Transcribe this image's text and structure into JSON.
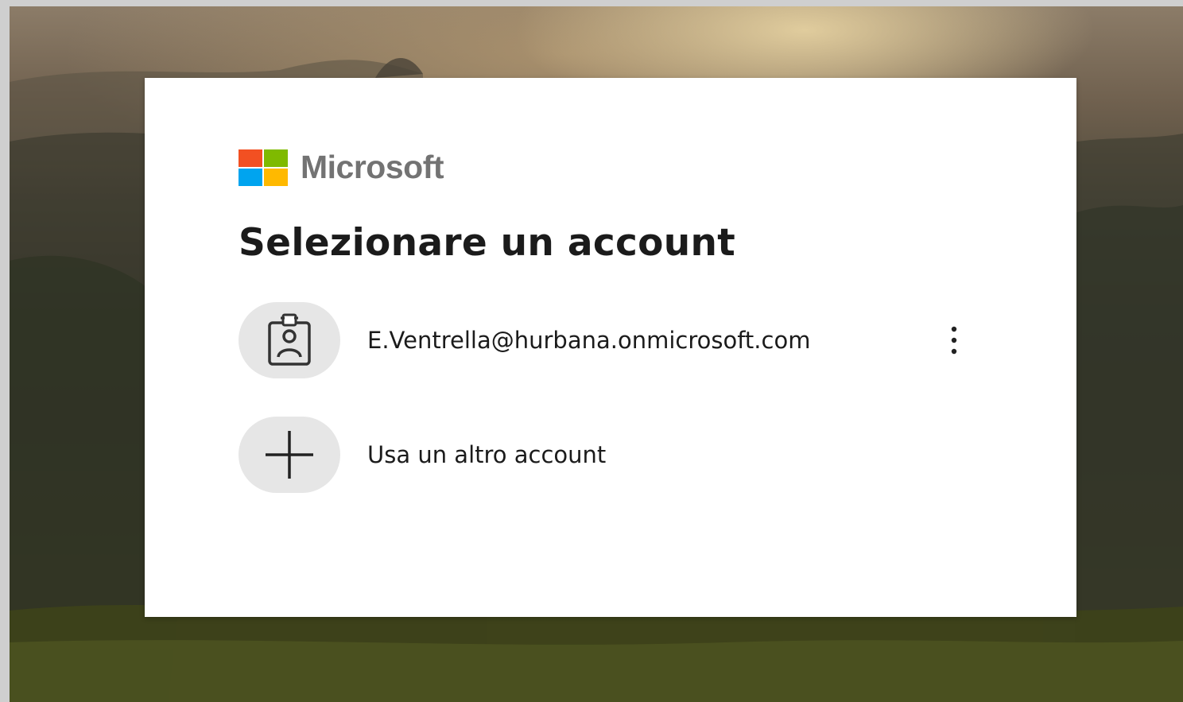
{
  "brand": {
    "name": "Microsoft",
    "logo_colors": [
      "#f25022",
      "#7fba00",
      "#00a4ef",
      "#ffb900"
    ]
  },
  "page": {
    "title": "Selezionare un account"
  },
  "accounts": [
    {
      "email": "E.Ventrella@hurbana.onmicrosoft.com",
      "icon": "badge-person-icon",
      "options_icon": "more-options-icon"
    }
  ],
  "other_account": {
    "label": "Usa un altro account",
    "icon": "plus-icon"
  }
}
